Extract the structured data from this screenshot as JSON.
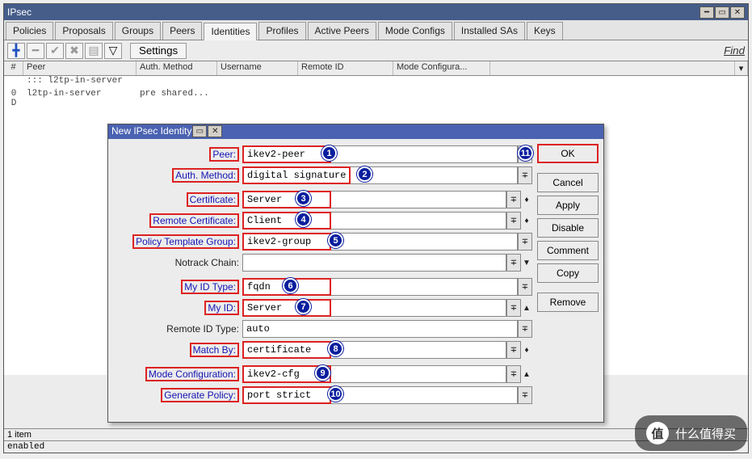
{
  "window": {
    "title": "IPsec"
  },
  "tabs": [
    "Policies",
    "Proposals",
    "Groups",
    "Peers",
    "Identities",
    "Profiles",
    "Active Peers",
    "Mode Configs",
    "Installed SAs",
    "Keys"
  ],
  "active_tab_index": 4,
  "toolbar": {
    "settings": "Settings",
    "find": "Find"
  },
  "grid": {
    "headers": {
      "idx": "#",
      "peer": "Peer",
      "auth": "Auth. Method",
      "user": "Username",
      "remote": "Remote ID",
      "mode": "Mode Configura..."
    },
    "rows": [
      {
        "flag": "",
        "idx": "",
        "peer": "::: l2tp-in-server",
        "auth": "",
        "user": "",
        "remote": "",
        "mode": ""
      },
      {
        "flag": "0 D",
        "idx": "",
        "peer": "l2tp-in-server",
        "auth": "pre shared...",
        "user": "",
        "remote": "",
        "mode": ""
      }
    ]
  },
  "statusbar": {
    "count": "1 item",
    "state": "enabled"
  },
  "dialog": {
    "title": "New IPsec Identity",
    "fields": {
      "peer": {
        "label": "Peer:",
        "value": "ikev2-peer",
        "badge": "1",
        "hi": true,
        "arrow": ""
      },
      "auth": {
        "label": "Auth. Method:",
        "value": "digital signature",
        "badge": "2",
        "hi": true,
        "arrow": ""
      },
      "cert": {
        "label": "Certificate:",
        "value": "Server",
        "badge": "3",
        "hi": true,
        "arrow": "updn"
      },
      "rcert": {
        "label": "Remote Certificate:",
        "value": "Client",
        "badge": "4",
        "hi": true,
        "arrow": "updn"
      },
      "ptg": {
        "label": "Policy Template Group:",
        "value": "ikev2-group",
        "badge": "5",
        "hi": true,
        "arrow": ""
      },
      "notrack": {
        "label": "Notrack Chain:",
        "value": "",
        "badge": "",
        "hi": false,
        "arrow": "dn"
      },
      "myidtype": {
        "label": "My ID Type:",
        "value": "fqdn",
        "badge": "6",
        "hi": true,
        "arrow": ""
      },
      "myid": {
        "label": "My ID:",
        "value": "Server",
        "badge": "7",
        "hi": true,
        "arrow": "up"
      },
      "remidtype": {
        "label": "Remote ID Type:",
        "value": "auto",
        "badge": "",
        "hi": false,
        "arrow": ""
      },
      "matchby": {
        "label": "Match By:",
        "value": "certificate",
        "badge": "8",
        "hi": true,
        "arrow": "updn"
      },
      "modecfg": {
        "label": "Mode Configuration:",
        "value": "ikev2-cfg",
        "badge": "9",
        "hi": true,
        "arrow": "up-solid"
      },
      "genpolicy": {
        "label": "Generate Policy:",
        "value": "port strict",
        "badge": "10",
        "hi": true,
        "arrow": ""
      }
    },
    "actions": [
      "OK",
      "Cancel",
      "Apply",
      "Disable",
      "Comment",
      "Copy",
      "Remove"
    ],
    "ok_badge": "11"
  },
  "watermark": "什么值得买"
}
